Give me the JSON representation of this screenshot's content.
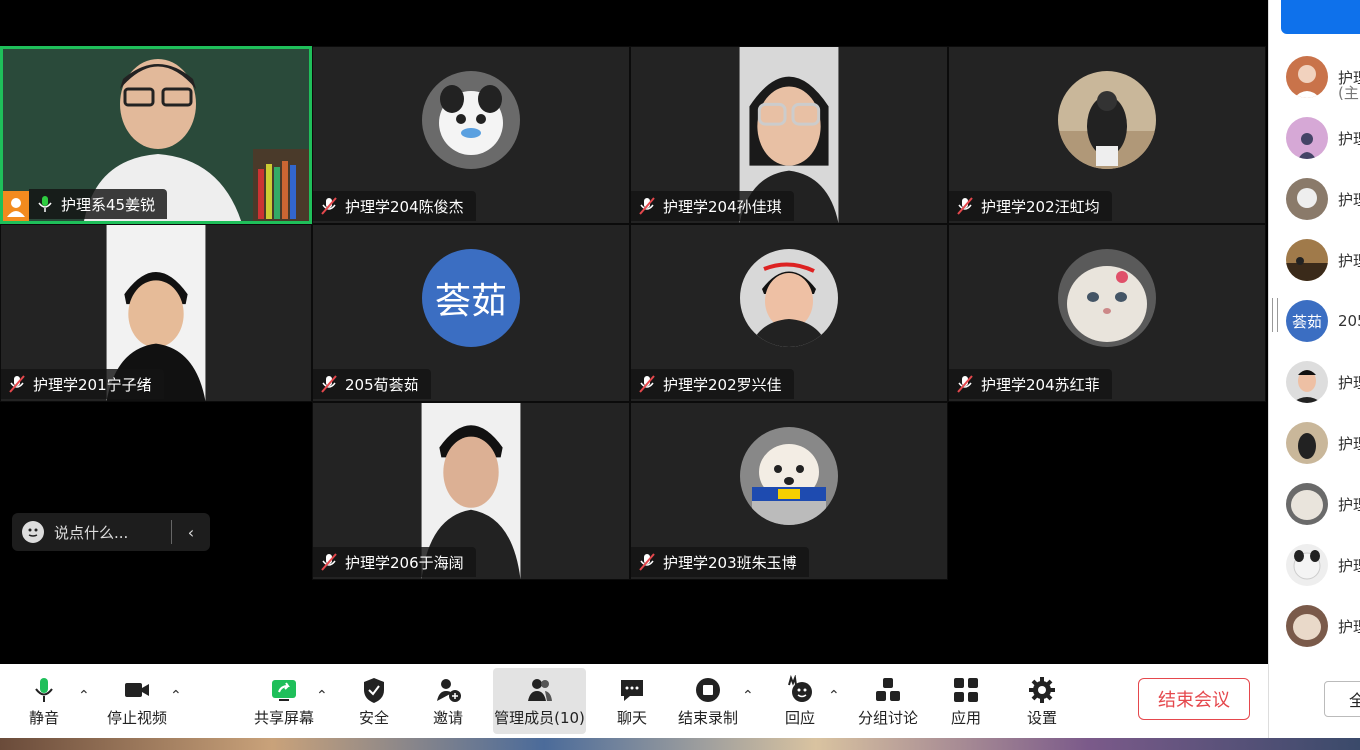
{
  "tiles": [
    {
      "name": "护理系45姜锐",
      "active": true,
      "mic": "on"
    },
    {
      "name": "护理学204陈俊杰",
      "mic": "off"
    },
    {
      "name": "护理学204孙佳琪",
      "mic": "off"
    },
    {
      "name": "护理学202汪虹均",
      "mic": "off"
    },
    {
      "name": "护理学201宁子绪",
      "mic": "off"
    },
    {
      "name": "205荀荟茹",
      "mic": "off",
      "initials": "荟茹"
    },
    {
      "name": "护理学202罗兴佳",
      "mic": "off"
    },
    {
      "name": "护理学204苏红菲",
      "mic": "off"
    },
    {
      "name": "护理学206于海阔",
      "mic": "off"
    },
    {
      "name": "护理学203班朱玉博",
      "mic": "off"
    }
  ],
  "chat": {
    "placeholder": "说点什么...",
    "collapse_icon": "chevron-left-icon"
  },
  "toolbar": {
    "mute": "静音",
    "stop_video": "停止视频",
    "share_screen": "共享屏幕",
    "security": "安全",
    "invite": "邀请",
    "participants": "管理成员(10)",
    "chat": "聊天",
    "end_recording": "结束录制",
    "reactions": "回应",
    "breakout": "分组讨论",
    "apps": "应用",
    "settings": "设置",
    "end_meeting": "结束会议"
  },
  "panel": {
    "rows": [
      {
        "name": "护理",
        "sub": "(主"
      },
      {
        "name": "护理"
      },
      {
        "name": "护理"
      },
      {
        "name": "护理"
      },
      {
        "name": "205",
        "initials": "荟茹"
      },
      {
        "name": "护理"
      },
      {
        "name": "护理"
      },
      {
        "name": "护理"
      },
      {
        "name": "护理"
      },
      {
        "name": "护理"
      }
    ],
    "bottom_button": "全"
  },
  "colors": {
    "accent": "#0e71eb",
    "active_border": "#1fbf5a",
    "end": "#e5484d",
    "muted": "#e5484d"
  }
}
